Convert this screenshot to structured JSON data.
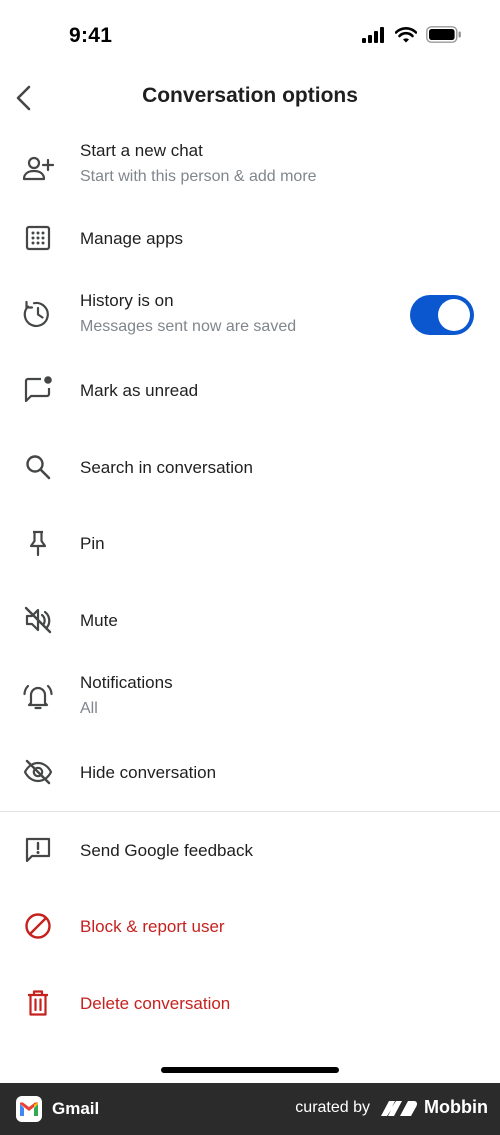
{
  "status_bar": {
    "time": "9:41"
  },
  "header": {
    "title": "Conversation options",
    "back_icon": "chevron-left-icon"
  },
  "colors": {
    "accent": "#0b57d0",
    "danger": "#c5221f",
    "secondary_text": "#80868b"
  },
  "menu": {
    "start_chat": {
      "label": "Start a new chat",
      "subtitle": "Start with this person & add more",
      "icon": "person-add-icon"
    },
    "manage_apps": {
      "label": "Manage apps",
      "icon": "apps-grid-icon"
    },
    "history": {
      "label": "History is on",
      "subtitle": "Messages sent now are saved",
      "icon": "history-icon",
      "toggle_on": true
    },
    "mark_unread": {
      "label": "Mark as unread",
      "icon": "mark-unread-icon"
    },
    "search": {
      "label": "Search in conversation",
      "icon": "search-icon"
    },
    "pin": {
      "label": "Pin",
      "icon": "pin-icon"
    },
    "mute": {
      "label": "Mute",
      "icon": "mute-icon"
    },
    "notifications": {
      "label": "Notifications",
      "subtitle": "All",
      "icon": "bell-ringing-icon"
    },
    "hide": {
      "label": "Hide conversation",
      "icon": "eye-off-icon"
    },
    "feedback": {
      "label": "Send Google feedback",
      "icon": "feedback-icon"
    },
    "block": {
      "label": "Block & report user",
      "icon": "block-icon"
    },
    "delete": {
      "label": "Delete conversation",
      "icon": "trash-icon"
    }
  },
  "footer": {
    "app_name": "Gmail",
    "curated_by": "curated by",
    "brand": "Mobbin"
  }
}
